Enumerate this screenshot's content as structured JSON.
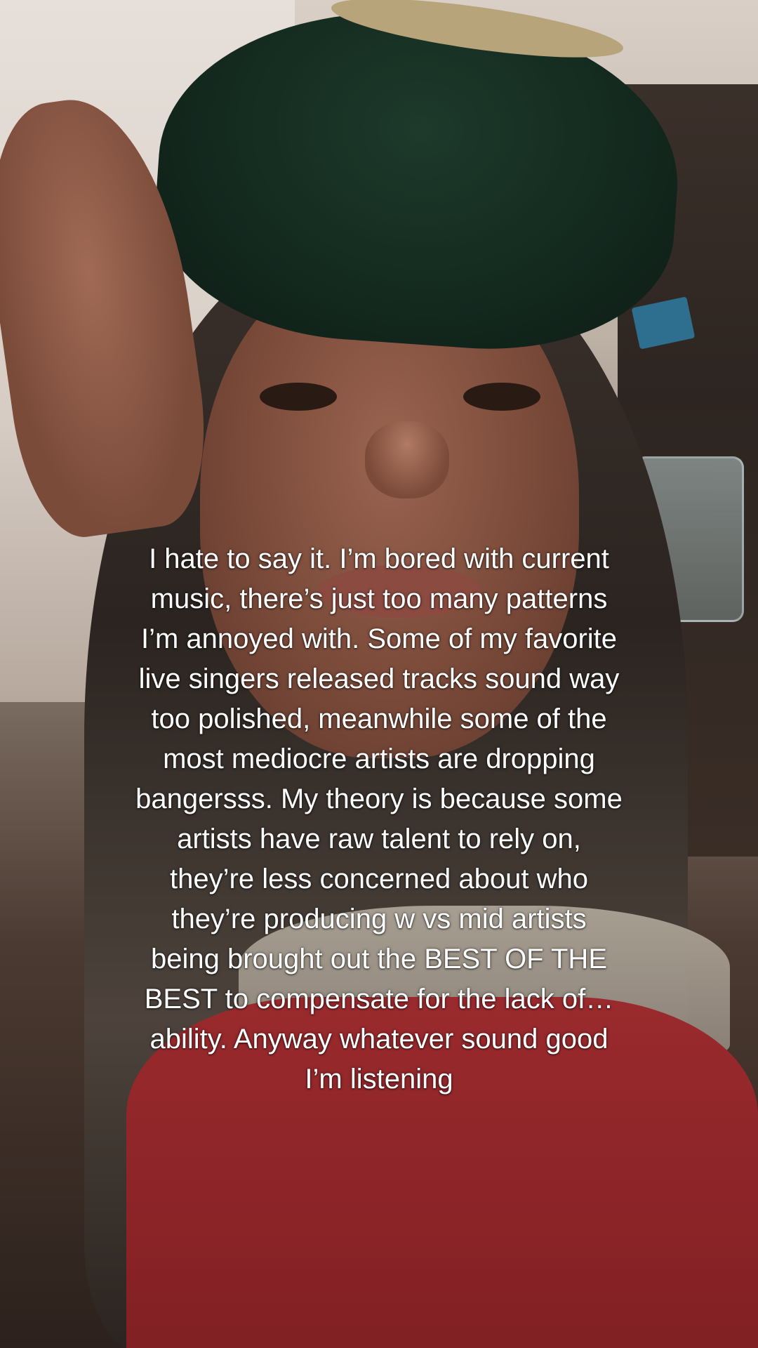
{
  "caption": {
    "lines": [
      "I hate to say it. I’m bored with current",
      "music, there’s just too many patterns",
      "I’m annoyed with. Some of my favorite",
      "live singers released tracks sound way",
      "too polished, meanwhile some of the",
      "most mediocre artists are dropping",
      "bangersss. My theory is because some",
      "artists have raw talent to rely on,",
      "they’re less concerned about who",
      "they’re producing w vs mid artists",
      "being brought out the BEST OF THE",
      "BEST to compensate for the lack of…",
      "ability. Anyway whatever sound good",
      "I’m listening"
    ]
  }
}
